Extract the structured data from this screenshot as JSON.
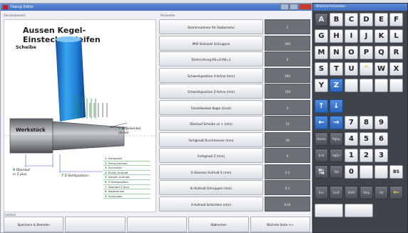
{
  "main_window": {
    "title": "Dialog Editor"
  },
  "left_group_label": "Zeichenbereich",
  "right_group_label": "Parameter",
  "diagram": {
    "title": "Aussen Kegel-Einstechschleifen",
    "scheibe": "Scheibe",
    "werkstueck": "Werkstück",
    "kegelwinkel_num": "8",
    "kegelwinkel_text": "Kegelwinkel",
    "kegelwinkel_sub": "(Grad)",
    "ueberlauf_num": "9",
    "ueberlauf_text": "Überlauf",
    "ueberlauf_sub": "in Z plus",
    "zstart_num": "7",
    "zstart_text": "Z-Startposition",
    "legend": [
      {
        "n": "1",
        "t": "Fertigmaß"
      },
      {
        "n": "2",
        "t": "Feinschlichten"
      },
      {
        "n": "3",
        "t": "Schlichten"
      },
      {
        "n": "4",
        "t": "Erstes Aufmaß"
      },
      {
        "n": "5",
        "t": "Starten Aufmaß"
      },
      {
        "n": "6",
        "t": "Z-Startposition"
      },
      {
        "n": "7",
        "t": "Überlauf Z plus"
      },
      {
        "n": "8",
        "t": "Kegelwinkel"
      },
      {
        "n": "9",
        "t": "Ausfunken"
      }
    ]
  },
  "parameters": [
    {
      "label": "Stammnummer für Stabornetur",
      "value": "1"
    },
    {
      "label": "MSP Drehzahl Schruppen",
      "value": "100"
    },
    {
      "label": "Drehrichtung M3=0 M4=1",
      "value": "0"
    },
    {
      "label": "Schwenkposition X-Achse (mm)",
      "value": "300"
    },
    {
      "label": "Schwenkposition Z-Achse (mm)",
      "value": "150"
    },
    {
      "label": "Einstellwinkel Kegel (Grad)",
      "value": "5"
    },
    {
      "label": "Überlauf Scheibe vo + (mm)",
      "value": "10"
    },
    {
      "label": "Fertigmaß Durchmesser (mm)",
      "value": "50"
    },
    {
      "label": "Fertigmaß Z (mm)",
      "value": "0"
    },
    {
      "label": "X-Gleiches Aufmaß X (mm)",
      "value": "0.1"
    },
    {
      "label": "Kr-Aufmaß Schruppen (mm)",
      "value": "0.1"
    },
    {
      "label": "X-Aufmaß Schlichten (mm)",
      "value": "0.04"
    }
  ],
  "footer": {
    "label": "Funktion",
    "buttons": [
      "Speichern & Beenden",
      "",
      "",
      "Abbrechen",
      "Nächste Seite >>"
    ]
  },
  "keyboard": {
    "title": "Bildschirmtastatur",
    "keys": {
      "r0": [
        "A",
        "B",
        "C",
        "D",
        "E",
        "F"
      ],
      "r1": [
        "G",
        "H",
        "I",
        "J",
        "K",
        "L"
      ],
      "r2": [
        "M",
        "N",
        "O",
        "P",
        "Q",
        "R"
      ],
      "r3": [
        "S",
        "T",
        "U",
        "^",
        "W",
        "X"
      ],
      "r4": [
        "Y",
        "Z"
      ],
      "r6": [
        "↑",
        "↓"
      ],
      "r7": [
        "←",
        "→",
        "7",
        "8",
        "9"
      ],
      "r8": [
        "Home",
        "PgUp",
        "4",
        "5",
        "6"
      ],
      "r9": [
        "End",
        "PgDn",
        "1",
        "2",
        "3"
      ],
      "r10": [
        "↹",
        "Tab",
        "0",
        "BS"
      ],
      "r11": [
        "Esc",
        "Entf",
        "Shift",
        "Strg",
        "Alt",
        "←"
      ]
    }
  }
}
